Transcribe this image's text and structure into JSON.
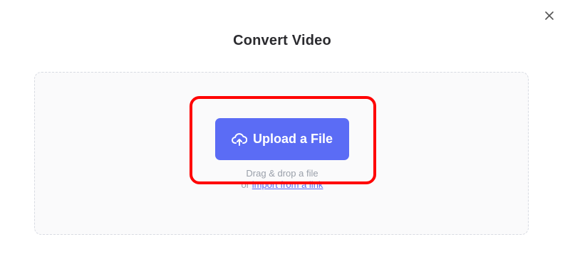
{
  "dialog": {
    "title": "Convert Video",
    "close_icon": "close-icon"
  },
  "dropzone": {
    "upload_button_label": "Upload a File",
    "upload_icon": "cloud-upload-icon",
    "drag_hint": "Drag & drop a file",
    "or_text": "or",
    "import_link_label": "import from a link"
  },
  "colors": {
    "accent": "#5b6cf5",
    "highlight": "#ff0000",
    "title": "#2b2b2f",
    "hint": "#9aa0aa"
  }
}
